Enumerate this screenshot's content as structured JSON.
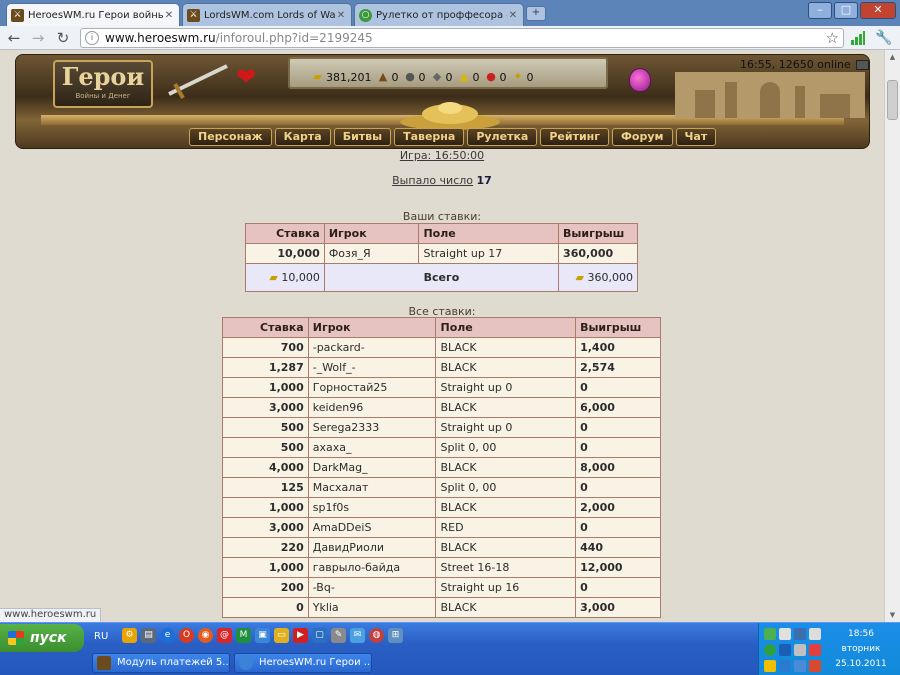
{
  "browser": {
    "tabs": [
      {
        "title": "HeroesWM.ru Герои войны и",
        "active": true
      },
      {
        "title": "LordsWM.com Lords of War an",
        "active": false
      },
      {
        "title": "Рулетко от проффесора - де",
        "active": false
      }
    ],
    "new_tab": "+",
    "window_controls": {
      "minimize": "–",
      "maximize": "□",
      "close": "✕"
    },
    "address_host": "www.heroeswm.ru",
    "address_path": "/inforoul.php?id=2199245",
    "status_url": "www.heroeswm.ru"
  },
  "header": {
    "logo_main": "Герои",
    "logo_sub": "Войны и Денег",
    "resources": [
      {
        "icon": "gold-icon",
        "value": "381,201"
      },
      {
        "icon": "wood-icon",
        "value": "0"
      },
      {
        "icon": "ore-icon",
        "value": "0"
      },
      {
        "icon": "mercury-icon",
        "value": "0"
      },
      {
        "icon": "sulfur-icon",
        "value": "0"
      },
      {
        "icon": "crystal-icon",
        "value": "0"
      },
      {
        "icon": "gems-icon",
        "value": "0"
      }
    ],
    "time_online": "16:55, 12650 online",
    "nav": [
      "Персонаж",
      "Карта",
      "Битвы",
      "Таверна",
      "Рулетка",
      "Рейтинг",
      "Форум",
      "Чат"
    ]
  },
  "game": {
    "time_text": "Игра: 16:50:00",
    "result_label": "Выпало число",
    "result_number": "17"
  },
  "your_bets": {
    "caption": "Ваши ставки:",
    "headers": [
      "Ставка",
      "Игрок",
      "Поле",
      "Выигрыш"
    ],
    "rows": [
      {
        "bet": "10,000",
        "player": "Фозя_Я",
        "field": "Straight up 17",
        "win": "360,000"
      }
    ],
    "total": {
      "bet": "10,000",
      "label": "Всего",
      "win": "360,000"
    }
  },
  "all_bets": {
    "caption": "Все ставки:",
    "headers": [
      "Ставка",
      "Игрок",
      "Поле",
      "Выигрыш"
    ],
    "rows": [
      {
        "bet": "700",
        "player": "-packard-",
        "field": "BLACK",
        "win": "1,400"
      },
      {
        "bet": "1,287",
        "player": "-_Wolf_-",
        "field": "BLACK",
        "win": "2,574"
      },
      {
        "bet": "1,000",
        "player": "Горностай25",
        "field": "Straight up 0",
        "win": "0"
      },
      {
        "bet": "3,000",
        "player": "keiden96",
        "field": "BLACK",
        "win": "6,000"
      },
      {
        "bet": "500",
        "player": "Serega2333",
        "field": "Straight up 0",
        "win": "0"
      },
      {
        "bet": "500",
        "player": "ахаха_",
        "field": "Split 0, 00",
        "win": "0"
      },
      {
        "bet": "4,000",
        "player": "DarkMag_",
        "field": "BLACK",
        "win": "8,000"
      },
      {
        "bet": "125",
        "player": "Масхалат",
        "field": "Split 0, 00",
        "win": "0"
      },
      {
        "bet": "1,000",
        "player": "sp1f0s",
        "field": "BLACK",
        "win": "2,000"
      },
      {
        "bet": "3,000",
        "player": "AmaDDeiS",
        "field": "RED",
        "win": "0"
      },
      {
        "bet": "220",
        "player": "ДавидРиоли",
        "field": "BLACK",
        "win": "440"
      },
      {
        "bet": "1,000",
        "player": "гаврыло-байда",
        "field": "Street 16-18",
        "win": "12,000"
      },
      {
        "bet": "200",
        "player": "-Bq-",
        "field": "Straight up 16",
        "win": "0"
      },
      {
        "bet": "0",
        "player": "Yklia",
        "field": "BLACK",
        "win": "3,000"
      }
    ]
  },
  "taskbar": {
    "start": "пуск",
    "lang": "RU",
    "tasks": [
      "Модуль платежей 5...",
      "HeroesWM.ru Герои ..."
    ],
    "clock_time": "18:56",
    "clock_day": "вторник",
    "clock_date": "25.10.2011"
  }
}
